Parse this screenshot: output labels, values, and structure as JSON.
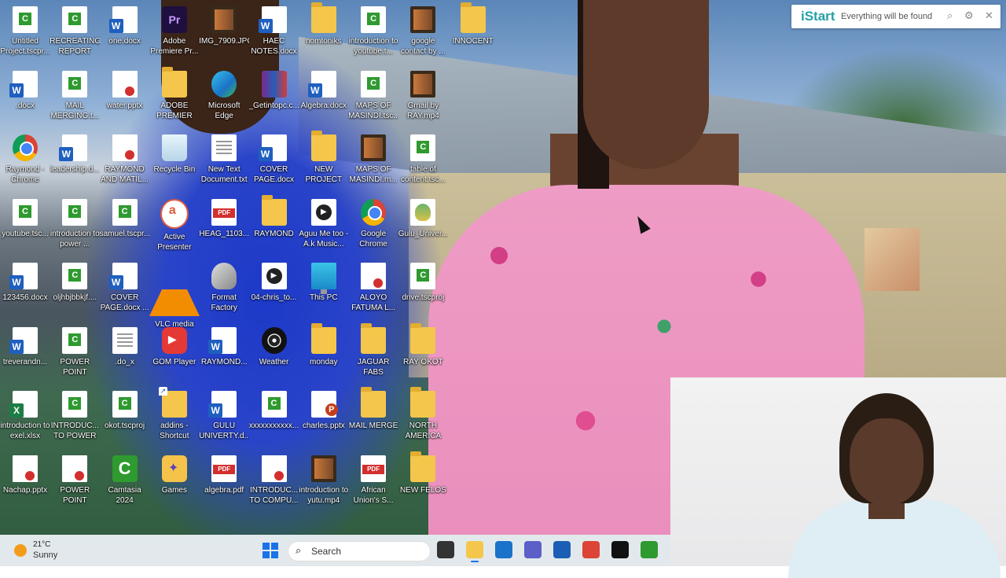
{
  "desktop": {
    "icons": [
      {
        "label": "Untitled Project.tscpr...",
        "kind": "camtasia-file",
        "icon": "camtasia-file-icon"
      },
      {
        "label": "RECREATING REPORT CA...",
        "kind": "camtasia-file",
        "icon": "camtasia-file-icon"
      },
      {
        "label": "one.docx",
        "kind": "word",
        "icon": "word-doc-icon"
      },
      {
        "label": "Adobe Premiere Pr...",
        "kind": "premiere",
        "icon": "premiere-pro-icon"
      },
      {
        "label": "IMG_7909.JPG",
        "kind": "image",
        "icon": "image-file-icon"
      },
      {
        "label": "HAEC NOTES.docx",
        "kind": "word",
        "icon": "word-doc-icon"
      },
      {
        "label": "nomtoniks",
        "kind": "folder",
        "icon": "folder-icon"
      },
      {
        "label": "introduction to youtube.t...",
        "kind": "camtasia-file",
        "icon": "camtasia-file-icon"
      },
      {
        "label": "google contact by ...",
        "kind": "video",
        "icon": "video-file-icon"
      },
      {
        "label": "INNOCENT",
        "kind": "folder",
        "icon": "folder-icon"
      },
      {
        "label": ".docx",
        "kind": "word",
        "icon": "word-doc-icon"
      },
      {
        "label": "MAIL MERGING.t...",
        "kind": "camtasia-file",
        "icon": "camtasia-file-icon"
      },
      {
        "label": "water.pptx",
        "kind": "ppt-thumb",
        "icon": "pptx-thumbnail-icon"
      },
      {
        "label": "ADOBE PREMIER PRO",
        "kind": "folder",
        "icon": "folder-icon"
      },
      {
        "label": "Microsoft Edge",
        "kind": "edge",
        "icon": "edge-icon"
      },
      {
        "label": "_Getintopc.c...",
        "kind": "winrar",
        "icon": "winrar-icon"
      },
      {
        "label": "Algebra.docx",
        "kind": "word",
        "icon": "word-doc-icon"
      },
      {
        "label": "MAPS OF MASINDI.tsc...",
        "kind": "camtasia-file",
        "icon": "camtasia-file-icon"
      },
      {
        "label": "Gmail by RAY.mp4",
        "kind": "video",
        "icon": "video-file-icon"
      },
      {
        "label": "Raymond - Chrome",
        "kind": "chrome",
        "icon": "chrome-profile-icon"
      },
      {
        "label": "leadership.d...",
        "kind": "word",
        "icon": "word-doc-icon"
      },
      {
        "label": "RAYMOND AND MATIL...",
        "kind": "ppt-thumb",
        "icon": "pptx-thumbnail-icon"
      },
      {
        "label": "Recycle Bin",
        "kind": "bin",
        "icon": "recycle-bin-icon"
      },
      {
        "label": "New Text Document.txt",
        "kind": "text",
        "icon": "text-file-icon"
      },
      {
        "label": "COVER PAGE.docx",
        "kind": "word",
        "icon": "word-doc-icon"
      },
      {
        "label": "NEW PROJECT",
        "kind": "folder",
        "icon": "folder-icon"
      },
      {
        "label": "MAPS OF MASINDI.m...",
        "kind": "video",
        "icon": "video-file-icon"
      },
      {
        "label": "table of content.tsc...",
        "kind": "camtasia-file",
        "icon": "camtasia-file-icon"
      },
      {
        "label": "youtube.tsc...",
        "kind": "camtasia-file",
        "icon": "camtasia-file-icon"
      },
      {
        "label": "introduction to power ...",
        "kind": "camtasia-file",
        "icon": "camtasia-file-icon"
      },
      {
        "label": "samuel.tscpr...",
        "kind": "camtasia-file",
        "icon": "camtasia-file-icon"
      },
      {
        "label": "Active Presenter",
        "kind": "active",
        "icon": "active-presenter-icon"
      },
      {
        "label": "HEAG_1103...",
        "kind": "pdf",
        "icon": "pdf-file-icon"
      },
      {
        "label": "RAYMOND",
        "kind": "folder",
        "icon": "folder-icon"
      },
      {
        "label": "Aguu Me too - A.k Music...",
        "kind": "media",
        "icon": "media-file-icon"
      },
      {
        "label": "Google Chrome",
        "kind": "chrome",
        "icon": "chrome-icon"
      },
      {
        "label": "Gulu_Univer...",
        "kind": "logo",
        "icon": "gulu-university-logo-icon"
      },
      {
        "label": "123456.docx",
        "kind": "word",
        "icon": "word-doc-icon"
      },
      {
        "label": "oljhbjbbkjf....",
        "kind": "camtasia-file",
        "icon": "camtasia-file-icon"
      },
      {
        "label": "COVER PAGE.docx ...",
        "kind": "word",
        "icon": "word-doc-icon"
      },
      {
        "label": "VLC media player",
        "kind": "vlc",
        "icon": "vlc-icon"
      },
      {
        "label": "Format Factory",
        "kind": "format",
        "icon": "format-factory-icon"
      },
      {
        "label": "04-chris_to...",
        "kind": "media",
        "icon": "media-file-icon"
      },
      {
        "label": "This PC",
        "kind": "pc",
        "icon": "this-pc-icon"
      },
      {
        "label": "ALOYO FATUMA L...",
        "kind": "ppt-thumb",
        "icon": "pptx-thumbnail-icon"
      },
      {
        "label": "drive.tscproj",
        "kind": "camtasia-file",
        "icon": "camtasia-file-icon"
      },
      {
        "label": "treverandn...",
        "kind": "word",
        "icon": "word-doc-icon"
      },
      {
        "label": "POWER POINT PRES...",
        "kind": "camtasia-file",
        "icon": "camtasia-file-icon"
      },
      {
        "label": ".do_x",
        "kind": "text",
        "icon": "blank-file-icon"
      },
      {
        "label": "GOM Player",
        "kind": "gom",
        "icon": "gom-player-icon"
      },
      {
        "label": "RAYMOND...",
        "kind": "word",
        "icon": "word-doc-icon"
      },
      {
        "label": "Weather",
        "kind": "weather",
        "icon": "weather-app-icon"
      },
      {
        "label": "monday",
        "kind": "folder",
        "icon": "folder-icon"
      },
      {
        "label": "JAGUAR FABS",
        "kind": "folder",
        "icon": "folder-icon"
      },
      {
        "label": "RAY OKOT",
        "kind": "folder",
        "icon": "folder-icon"
      },
      {
        "label": "introduction to exel.xlsx",
        "kind": "excel",
        "icon": "excel-file-icon"
      },
      {
        "label": "INTRODUC... TO POWER ...",
        "kind": "camtasia-file",
        "icon": "camtasia-file-icon"
      },
      {
        "label": "okot.tscproj",
        "kind": "camtasia-file",
        "icon": "camtasia-file-icon"
      },
      {
        "label": "addins - Shortcut",
        "kind": "folder",
        "icon": "folder-shortcut-icon"
      },
      {
        "label": "GULU UNIVERTY.d...",
        "kind": "word",
        "icon": "word-doc-icon"
      },
      {
        "label": "xxxxxxxxxxx...",
        "kind": "camtasia-file",
        "icon": "camtasia-file-icon"
      },
      {
        "label": "charles.pptx",
        "kind": "ppt",
        "icon": "pptx-file-icon"
      },
      {
        "label": "MAIL MERGE",
        "kind": "folder",
        "icon": "folder-icon"
      },
      {
        "label": "NORTH AMERICA",
        "kind": "folder",
        "icon": "folder-icon"
      },
      {
        "label": "Nachap.pptx",
        "kind": "ppt-thumb",
        "icon": "pptx-thumbnail-icon"
      },
      {
        "label": "POWER POINT PRES...",
        "kind": "ppt-thumb",
        "icon": "pptx-thumbnail-icon"
      },
      {
        "label": "Camtasia 2024",
        "kind": "camtasia",
        "icon": "camtasia-app-icon"
      },
      {
        "label": "Games",
        "kind": "games",
        "icon": "games-icon"
      },
      {
        "label": "algebra.pdf",
        "kind": "pdf",
        "icon": "pdf-file-icon"
      },
      {
        "label": "INTRODUC... TO COMPU...",
        "kind": "ppt-thumb",
        "icon": "pptx-thumbnail-icon"
      },
      {
        "label": "introduction to yutu.mp4",
        "kind": "video",
        "icon": "video-file-icon"
      },
      {
        "label": "African Union's S...",
        "kind": "pdf",
        "icon": "pdf-file-icon"
      },
      {
        "label": "NEW FELOS",
        "kind": "folder",
        "icon": "folder-icon"
      }
    ]
  },
  "istart": {
    "brand": "iStart",
    "tagline": "Everything will be found",
    "icons": [
      "search-icon",
      "gear-icon",
      "close-icon"
    ]
  },
  "taskbar": {
    "weather_temp": "21°C",
    "weather_condition": "Sunny",
    "search_placeholder": "Search",
    "pinned": [
      {
        "name": "task-view-icon",
        "color": "#333333"
      },
      {
        "name": "file-explorer-icon",
        "color": "#f4c64b"
      },
      {
        "name": "edge-icon",
        "color": "#1a73c8"
      },
      {
        "name": "teams-icon",
        "color": "#5b5fc7"
      },
      {
        "name": "store-icon",
        "color": "#1a5fb4"
      },
      {
        "name": "chrome-icon",
        "color": "#db4437"
      },
      {
        "name": "tiktok-icon",
        "color": "#111111"
      },
      {
        "name": "camtasia-icon",
        "color": "#2f9a2f"
      }
    ]
  }
}
